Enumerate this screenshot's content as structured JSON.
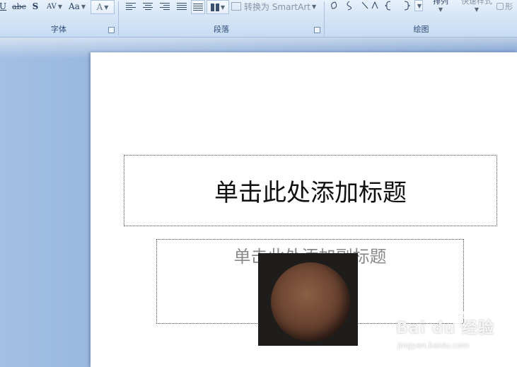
{
  "ribbon": {
    "font_group": {
      "label": "字体",
      "buttons": [
        {
          "name": "underline-button",
          "text": "U"
        },
        {
          "name": "strikethrough-button",
          "text": "abc"
        },
        {
          "name": "shadow-button",
          "text": "S"
        },
        {
          "name": "char-spacing-button",
          "text": "AV"
        },
        {
          "name": "change-case-button",
          "text": "Aa"
        },
        {
          "name": "font-color-button",
          "text": "A"
        }
      ]
    },
    "paragraph_group": {
      "label": "段落",
      "smartart_label": "转换为 SmartArt"
    },
    "drawing_group": {
      "label": "绘图",
      "arrange_label": "排列",
      "quick_styles_label": "快速样式",
      "shape_fill_label": "形"
    }
  },
  "slide": {
    "title_placeholder": "单击此处添加标题",
    "subtitle_placeholder": "单击此处添加副标题"
  },
  "watermark": {
    "brand": "Bai du 经验",
    "url": "jingyan.baidu.com"
  },
  "colors": {
    "ribbon_bg": "#d7e6f7",
    "workspace_bg": "#86a8d6",
    "slide_bg": "#ffffff"
  }
}
